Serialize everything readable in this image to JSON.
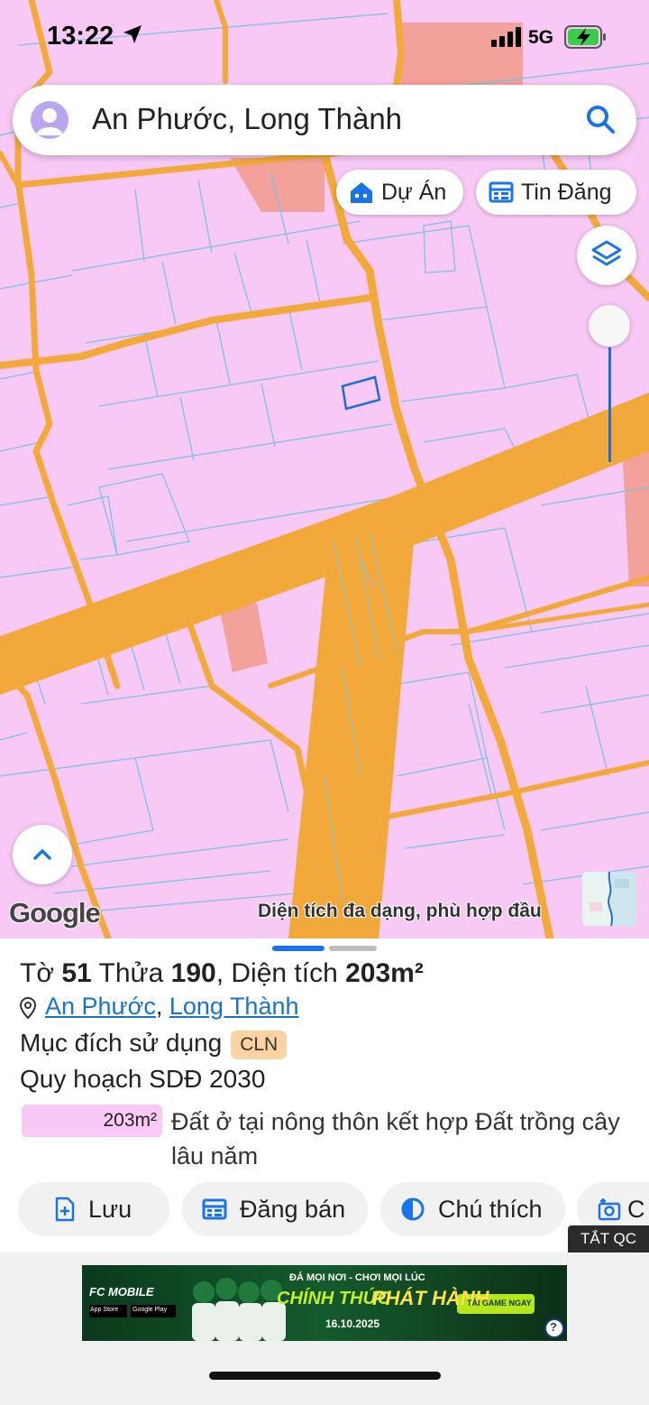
{
  "status_bar": {
    "time": "13:22",
    "network": "5G"
  },
  "search": {
    "query": "An Phước, Long Thành"
  },
  "map_chips": {
    "projects_label": "Dự Án",
    "listings_label": "Tin Đăng"
  },
  "map": {
    "attribution": "Google",
    "caption": "Diện tích đa dạng, phù hợp đầu"
  },
  "parcel": {
    "sheet_prefix": "Tờ",
    "sheet_number": "51",
    "plot_prefix": "Thửa",
    "plot_number": "190",
    "area_label": ", Diện tích",
    "area_value": "203m²",
    "ward": "An Phước",
    "district": "Long Thành",
    "purpose_label": "Mục đích sử dụng",
    "purpose_code": "CLN",
    "plan_label": "Quy hoạch SDĐ 2030",
    "plan_area": "203m²",
    "plan_description": "Đất ở tại nông thôn kết hợp Đất trồng cây lâu năm"
  },
  "actions": {
    "save": "Lưu",
    "sell": "Đăng bán",
    "legend": "Chú thích",
    "capture": "C"
  },
  "ad": {
    "close_label": "TẮT QC",
    "brand": "FC MOBILE",
    "tagline": "ĐÁ MỌI NƠI - CHƠI MỌI LÚC",
    "headline_1": "CHÍNH THỨC",
    "headline_2": "PHÁT HÀNH",
    "cta": "TẢI GAME NGAY",
    "date": "16.10.2025",
    "store_1": "App Store",
    "store_2": "Google Play"
  },
  "colors": {
    "land": "#f8c9f5",
    "road": "#f3a93a",
    "commercial": "#f2a29a",
    "link": "#1a73c8",
    "badge": "#fbd3a3",
    "accent": "#1c6fd6"
  }
}
